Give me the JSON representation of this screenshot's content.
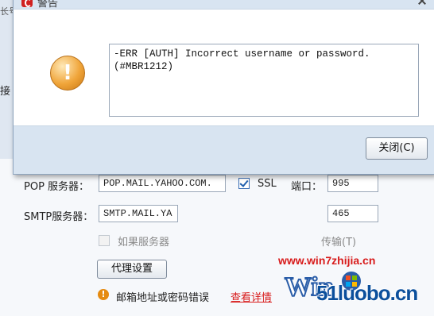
{
  "background": {
    "tab_fragment": "长号",
    "cut_label": "接",
    "pop": {
      "label": "POP 服务器：",
      "value": "POP.MAIL.YAHOO.COM."
    },
    "ssl": {
      "label": "SSL",
      "checked": true
    },
    "port": {
      "label": "端口：",
      "pop_value": "995",
      "smtp_value": "465"
    },
    "smtp": {
      "label": "SMTP服务器：",
      "value": "SMTP.MAIL.YA"
    },
    "server_option": {
      "label": "如果服务器",
      "checked": false,
      "enabled": false
    },
    "transfer_label": "传输(T)",
    "proxy_button": "代理设置",
    "status": {
      "icon": "warning-icon",
      "text": "邮箱地址或密码错误",
      "link": "查看详情"
    }
  },
  "dialog": {
    "title": "警告",
    "message": "-ERR [AUTH] Incorrect username or password.\n(#MBR1212)",
    "ok_button": "关闭(C)"
  },
  "watermark": {
    "url": "www.win7zhijia.cn",
    "brand": "51luobo.cn",
    "logo_text": "Win7家"
  }
}
